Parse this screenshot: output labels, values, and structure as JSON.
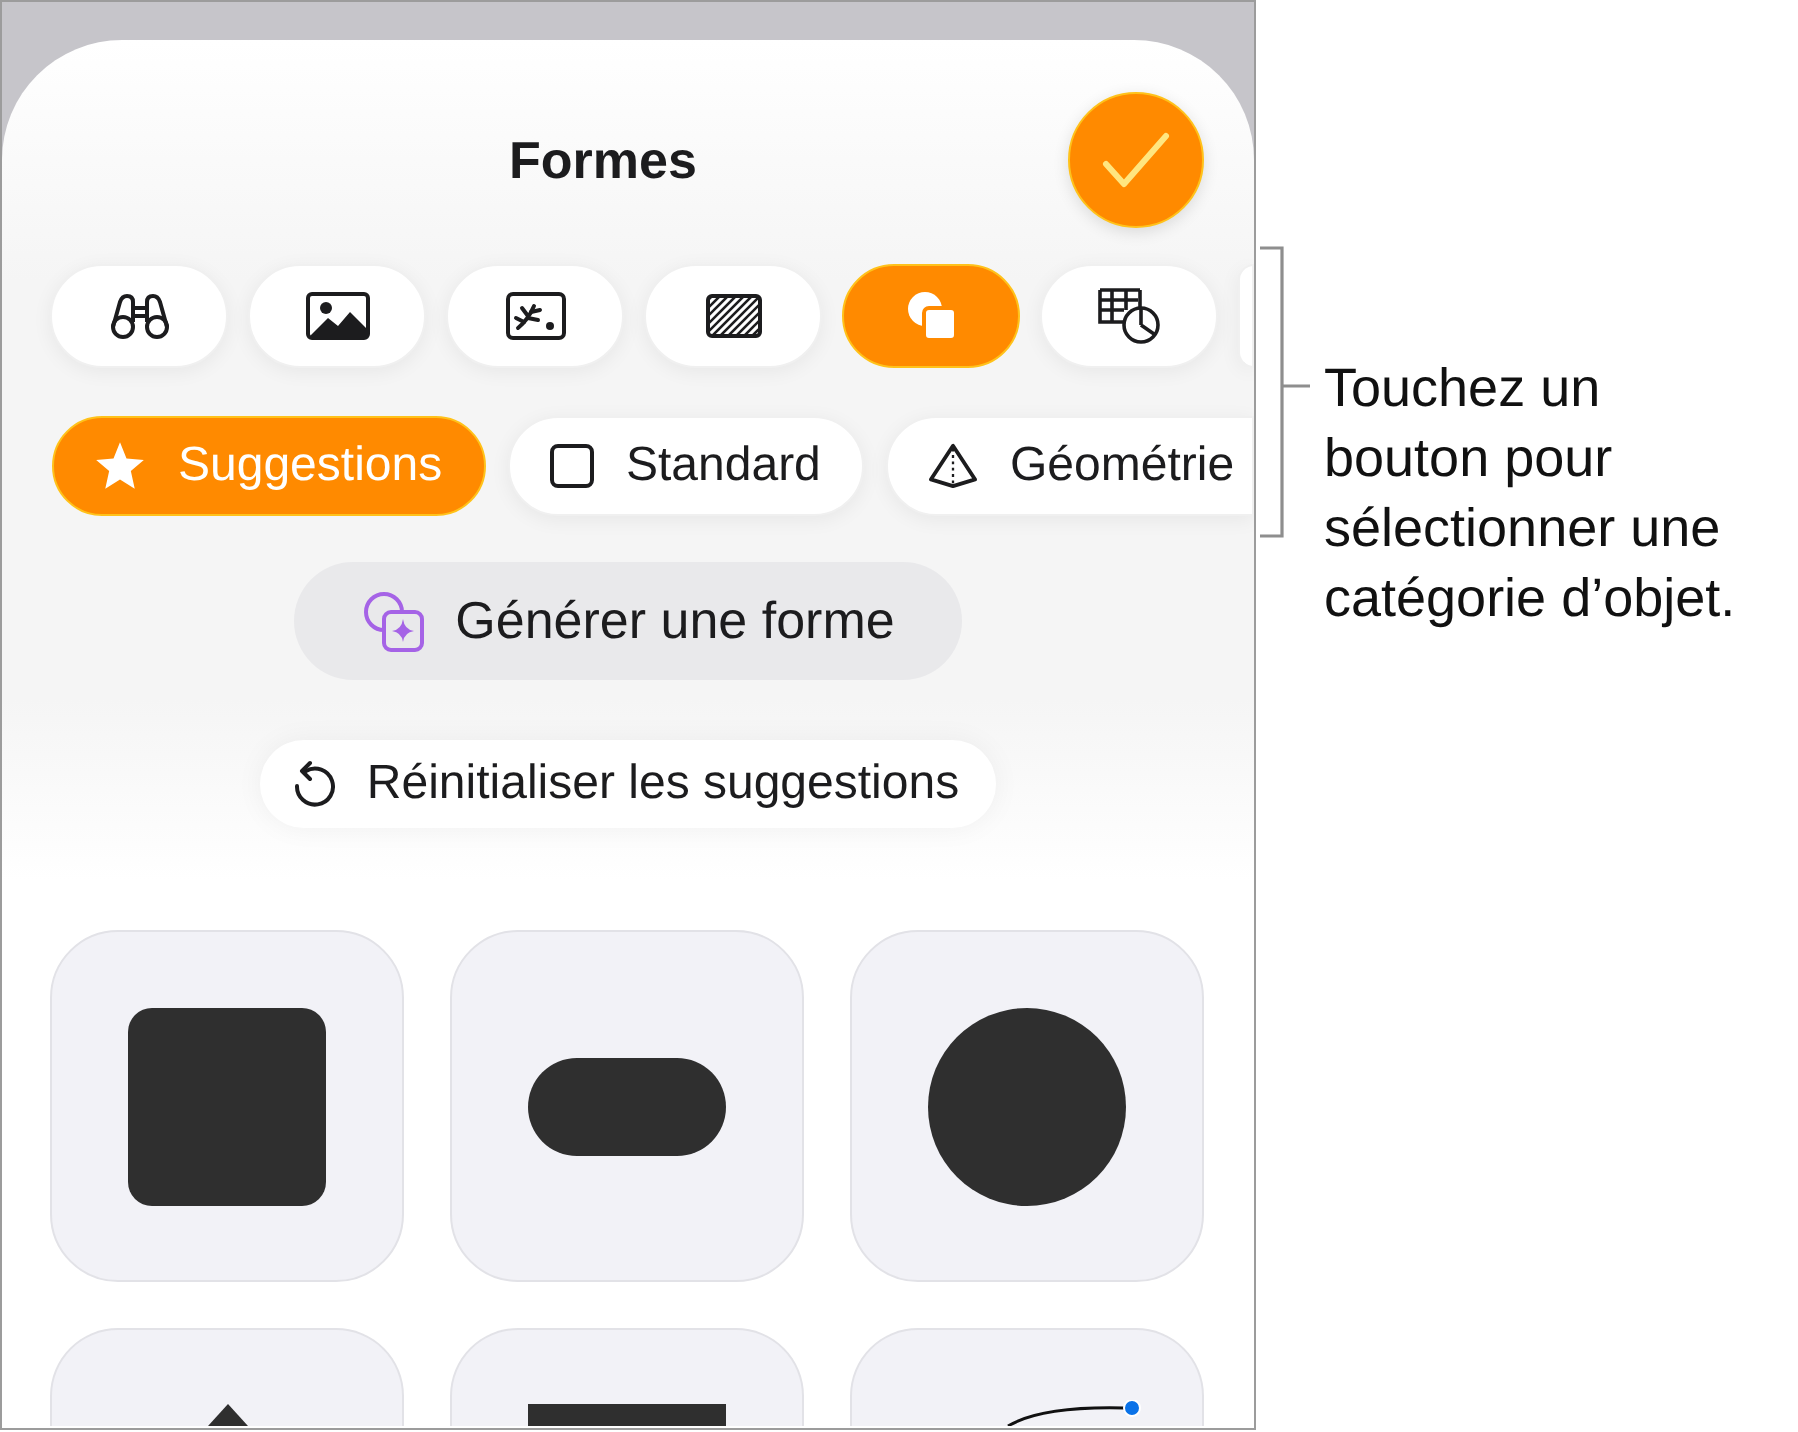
{
  "sheet": {
    "title": "Formes"
  },
  "object_tabs": [
    {
      "selected": false
    },
    {
      "selected": false
    },
    {
      "selected": false
    },
    {
      "selected": false
    },
    {
      "selected": true
    },
    {
      "selected": false
    },
    {
      "selected": false
    }
  ],
  "categories": [
    {
      "label": "Suggestions",
      "selected": true
    },
    {
      "label": "Standard",
      "selected": false
    },
    {
      "label": "Géométrie",
      "selected": false
    }
  ],
  "generate_button": {
    "label": "Générer une forme"
  },
  "reset_button": {
    "label": "Réinitialiser les suggestions"
  },
  "callout": {
    "text": "Touchez un bouton pour sélectionner une catégorie d’objet."
  }
}
